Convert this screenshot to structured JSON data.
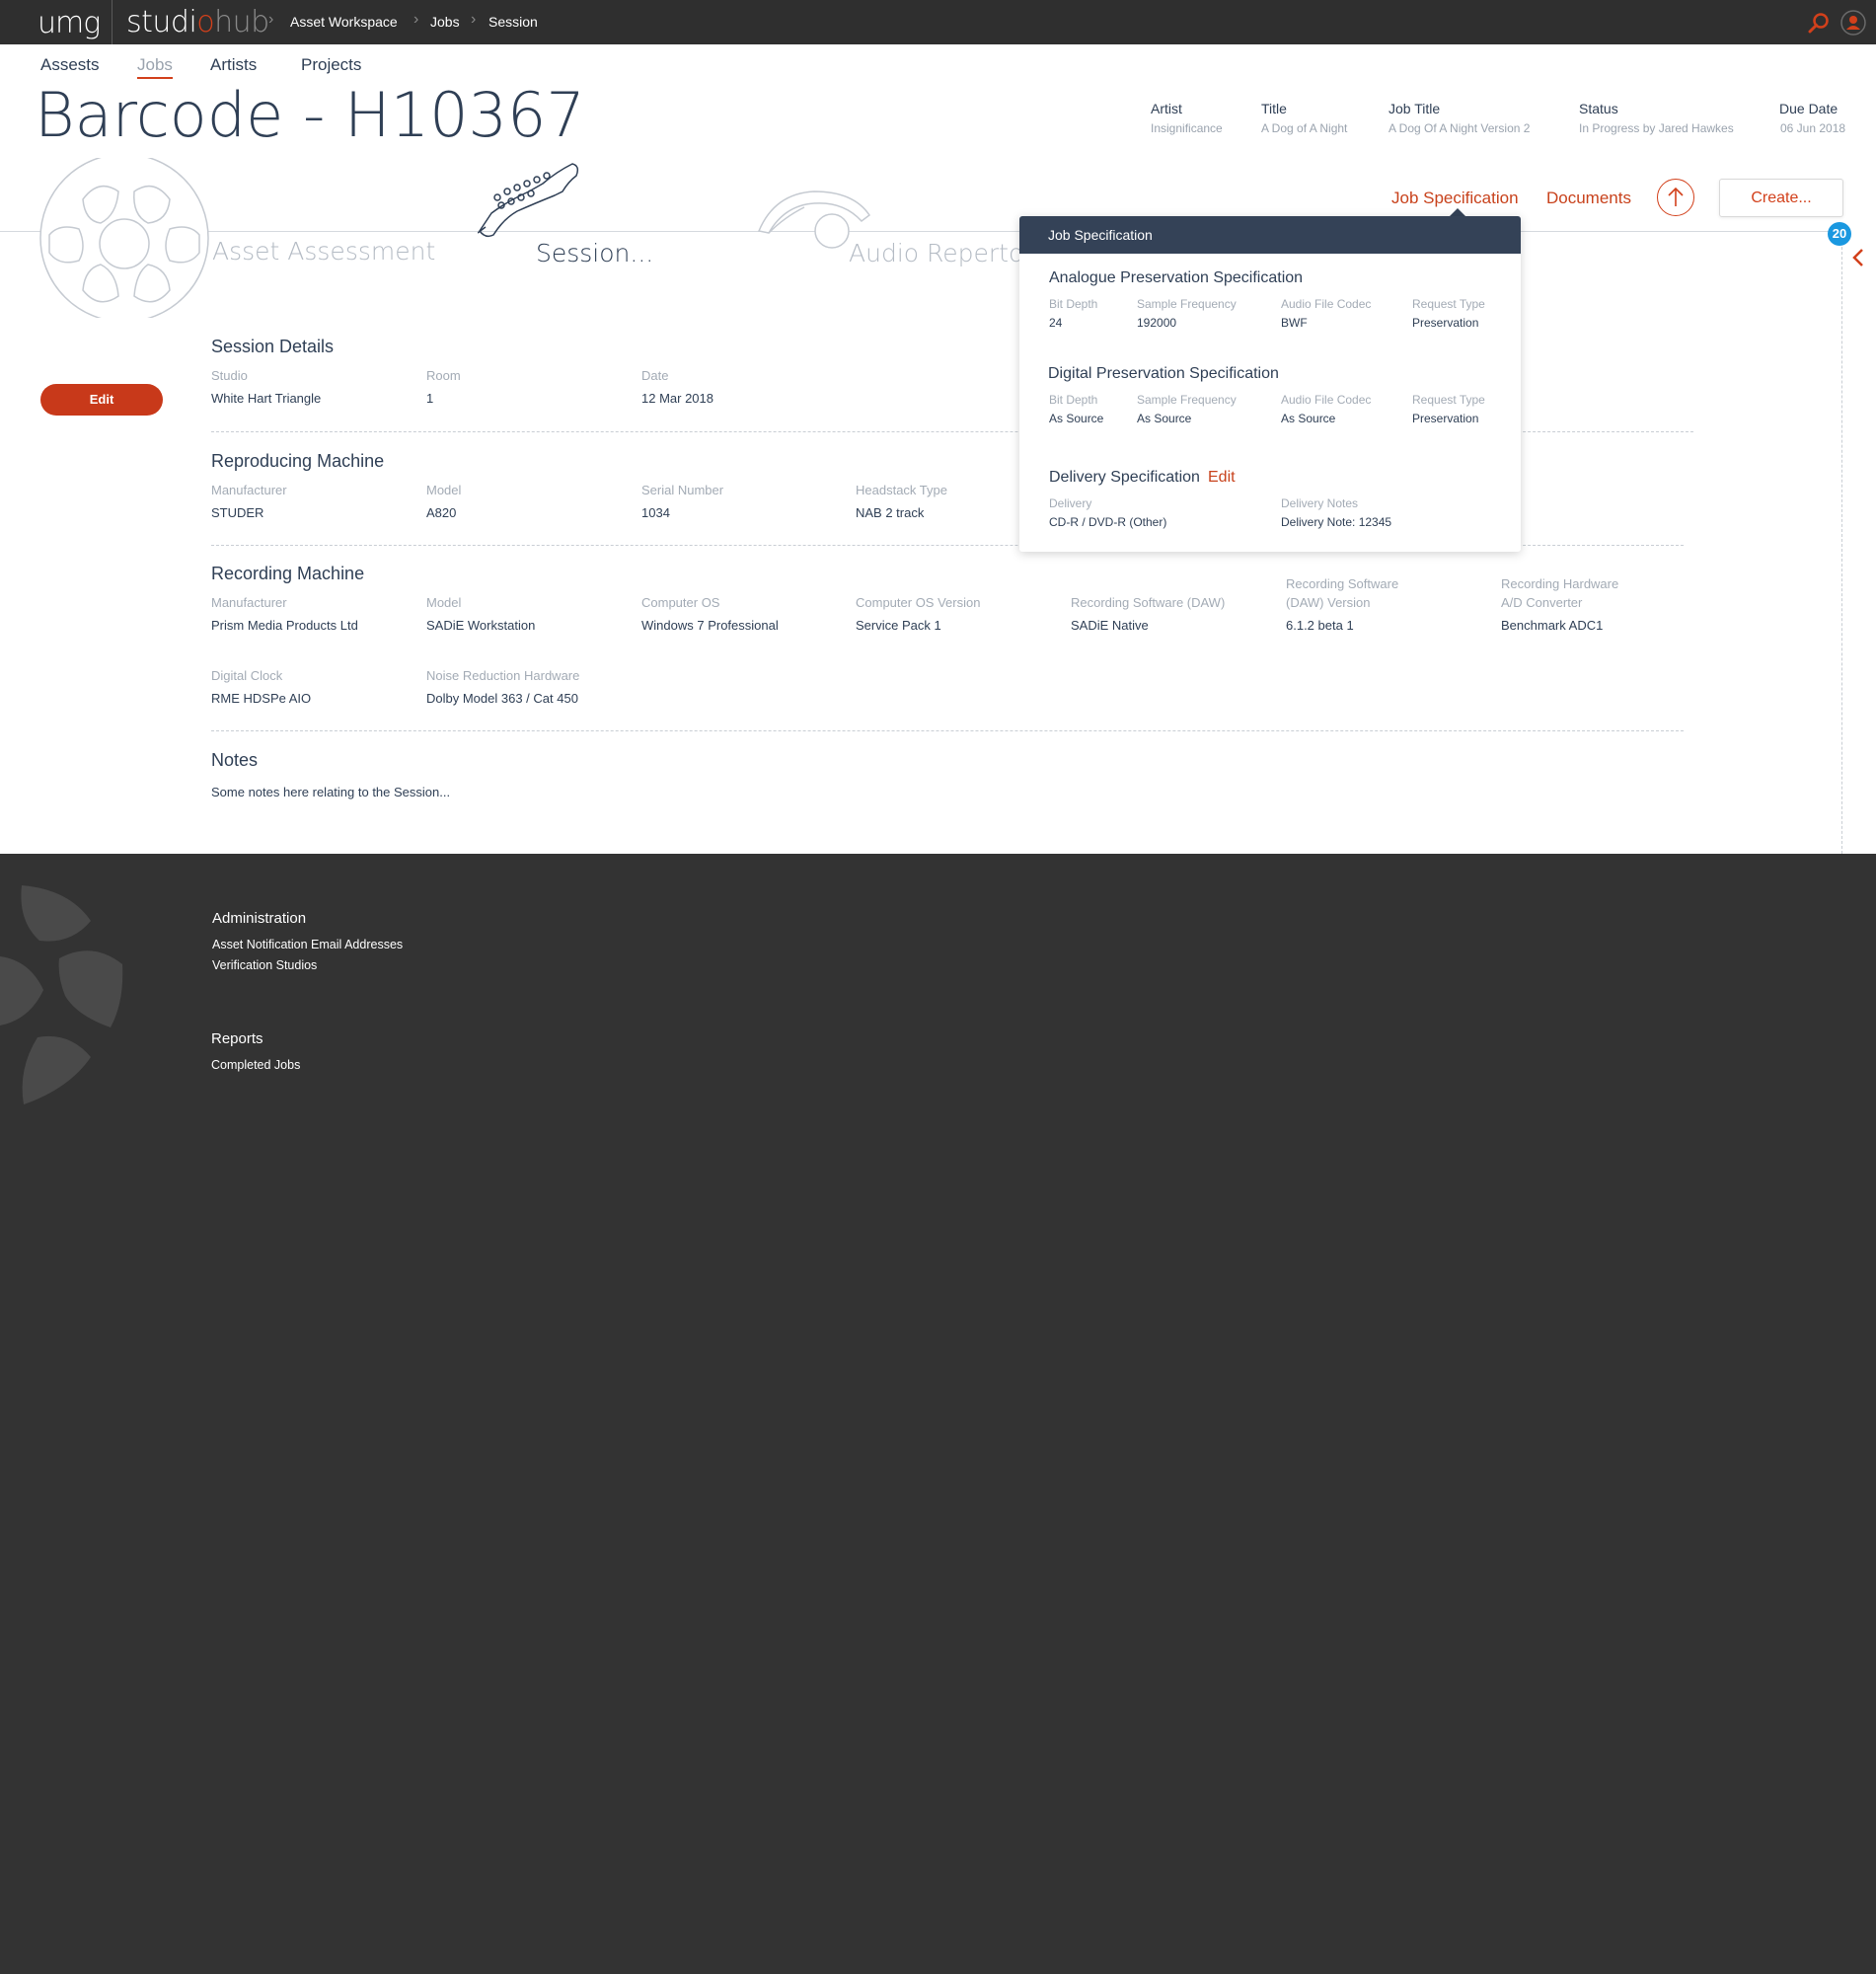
{
  "brand": {
    "umg": "umg",
    "studio": "studi",
    "power": "o",
    "hub": "hub"
  },
  "breadcrumb": [
    "Asset Workspace",
    "Jobs",
    "Session"
  ],
  "nav": {
    "tabs": [
      "Assests",
      "Jobs",
      "Artists",
      "Projects"
    ],
    "active": "Jobs"
  },
  "title": "Barcode - H10367",
  "meta": [
    {
      "label": "Artist",
      "value": "Insignificance"
    },
    {
      "label": "Title",
      "value": "A Dog of A Night"
    },
    {
      "label": "Job Title",
      "value": "A Dog Of A Night Version 2"
    },
    {
      "label": "Status",
      "value": "In Progress by Jared Hawkes"
    },
    {
      "label": "Due Date",
      "value": "06 Jun 2018"
    }
  ],
  "actions": {
    "job_spec": "Job Specification",
    "documents": "Documents",
    "create": "Create..."
  },
  "badge_count": "20",
  "stages": [
    "Asset Assessment",
    "Session...",
    "Audio Repertoire"
  ],
  "edit_label": "Edit",
  "session_details": {
    "title": "Session Details",
    "fields": [
      {
        "label": "Studio",
        "value": "White Hart Triangle"
      },
      {
        "label": "Room",
        "value": "1"
      },
      {
        "label": "Date",
        "value": "12 Mar 2018"
      }
    ]
  },
  "reproducing": {
    "title": "Reproducing Machine",
    "fields": [
      {
        "label": "Manufacturer",
        "value": "STUDER"
      },
      {
        "label": "Model",
        "value": "A820"
      },
      {
        "label": "Serial Number",
        "value": "1034"
      },
      {
        "label": "Headstack Type",
        "value": "NAB 2 track"
      }
    ]
  },
  "recording": {
    "title": "Recording Machine",
    "fields": [
      {
        "label": "Manufacturer",
        "value": "Prism Media Products Ltd"
      },
      {
        "label": "Model",
        "value": "SADiE Workstation"
      },
      {
        "label": "Computer OS",
        "value": "Windows 7 Professional"
      },
      {
        "label": "Computer OS Version",
        "value": "Service Pack 1"
      },
      {
        "label": "Recording Software (DAW)",
        "value": "SADiE Native"
      },
      {
        "label_line1": "Recording Software",
        "label_line2": "(DAW) Version",
        "value": "6.1.2 beta 1"
      },
      {
        "label_line1": "Recording Hardware",
        "label_line2": "A/D Converter",
        "value": "Benchmark ADC1"
      },
      {
        "label": "Digital Clock",
        "value": "RME HDSPe AIO"
      },
      {
        "label": "Noise Reduction Hardware",
        "value": "Dolby Model 363 / Cat 450"
      }
    ]
  },
  "notes": {
    "title": "Notes",
    "text": "Some notes here relating to the Session..."
  },
  "popover": {
    "header": "Job Specification",
    "analogue": {
      "title": "Analogue Preservation Specification",
      "fields": [
        {
          "label": "Bit Depth",
          "value": "24"
        },
        {
          "label": "Sample Frequency",
          "value": "192000"
        },
        {
          "label": "Audio File Codec",
          "value": "BWF"
        },
        {
          "label": "Request Type",
          "value": "Preservation"
        }
      ]
    },
    "digital": {
      "title": "Digital Preservation Specification",
      "fields": [
        {
          "label": "Bit Depth",
          "value": "As Source"
        },
        {
          "label": "Sample Frequency",
          "value": "As Source"
        },
        {
          "label": "Audio File Codec",
          "value": "As Source"
        },
        {
          "label": "Request Type",
          "value": "Preservation"
        }
      ]
    },
    "delivery": {
      "title": "Delivery Specification",
      "edit": "Edit",
      "fields": [
        {
          "label": "Delivery",
          "value": "CD-R / DVD-R (Other)"
        },
        {
          "label": "Delivery Notes",
          "value": "Delivery Note: 12345"
        }
      ]
    }
  },
  "footer": {
    "admin": {
      "title": "Administration",
      "links": [
        "Asset Notification Email Addresses",
        "Verification Studios"
      ]
    },
    "reports": {
      "title": "Reports",
      "links": [
        "Completed Jobs"
      ]
    }
  },
  "colors": {
    "accent": "#d2401b",
    "dark": "#2f2f2f",
    "navy": "#344257",
    "badge": "#1a98e0"
  },
  "icons": [
    "search-icon",
    "user-icon",
    "upload-icon",
    "chevron-left-icon",
    "reel-icon",
    "guitar-icon",
    "headphones-icon"
  ]
}
